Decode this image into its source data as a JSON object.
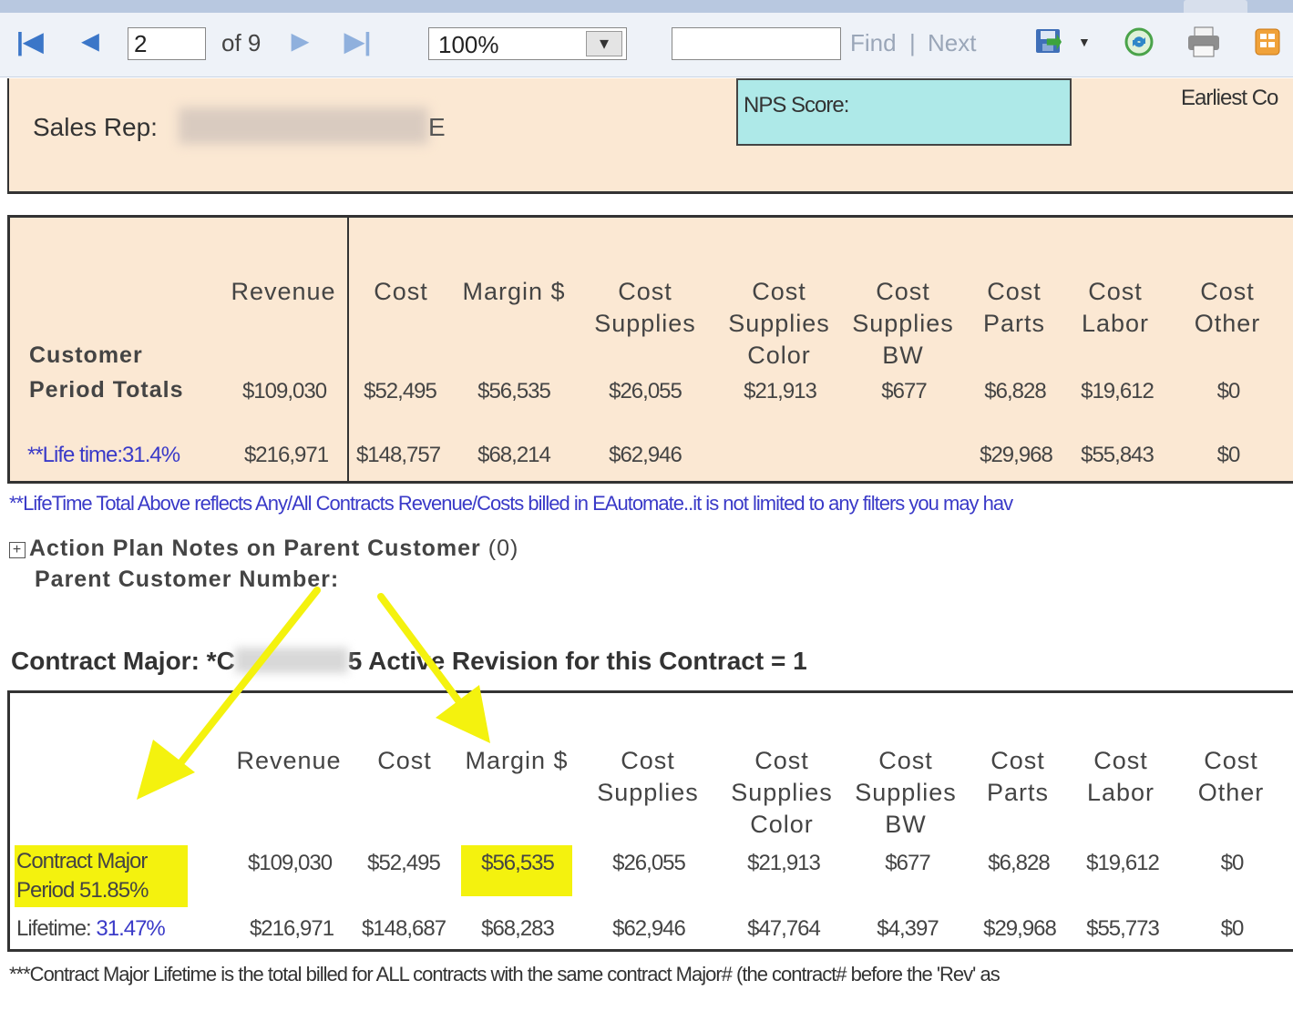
{
  "toolbar": {
    "page_value": "2",
    "of_label": "of 9",
    "zoom_value": "100%",
    "find_value": "",
    "find_label": "Find",
    "find_sep": "|",
    "next_label": "Next"
  },
  "header": {
    "sales_rep_label": "Sales Rep:",
    "sales_rep_suffix": "E",
    "nps_label": "NPS Score:",
    "earliest_label": "Earliest Co"
  },
  "customer_table": {
    "headers": [
      [
        "Revenue"
      ],
      [
        "Cost"
      ],
      [
        "Margin $"
      ],
      [
        "Cost",
        "Supplies"
      ],
      [
        "Cost",
        "Supplies",
        "Color"
      ],
      [
        "Cost",
        "Supplies",
        "BW"
      ],
      [
        "Cost",
        "Parts"
      ],
      [
        "Cost",
        "Labor"
      ],
      [
        "Cost",
        "Other"
      ]
    ],
    "row_label_1": "Customer",
    "row_label_2": "Period Totals",
    "period_values": [
      "$109,030",
      "$52,495",
      "$56,535",
      "$26,055",
      "$21,913",
      "$677",
      "$6,828",
      "$19,612",
      "$0"
    ],
    "lifetime_label": "**Life time:31.4%",
    "lifetime_values": [
      "$216,971",
      "$148,757",
      "$68,214",
      "$62,946",
      "",
      "",
      "$29,968",
      "$55,843",
      "$0"
    ]
  },
  "lifetime_note": "**LifeTime Total Above reflects Any/All Contracts Revenue/Costs billed in EAutomate..it is not limited to any filters you may hav",
  "action_plan": {
    "expand_glyph": "+",
    "label": "Action Plan Notes on Parent Customer",
    "count": "(0)"
  },
  "parent_customer_label": "Parent Customer Number:",
  "contract_title": {
    "prefix": "Contract Major: *C",
    "suffix": "5 Active Revision for this Contract = 1"
  },
  "contract_table": {
    "headers": [
      [
        "Revenue"
      ],
      [
        "Cost"
      ],
      [
        "Margin $"
      ],
      [
        "Cost",
        "Supplies"
      ],
      [
        "Cost",
        "Supplies",
        "Color"
      ],
      [
        "Cost",
        "Supplies",
        "BW"
      ],
      [
        "Cost",
        "Parts"
      ],
      [
        "Cost",
        "Labor"
      ],
      [
        "Cost",
        "Other"
      ]
    ],
    "period_label_1": "Contract Major",
    "period_label_2": "Period 51.85%",
    "period_values": [
      "$109,030",
      "$52,495",
      "$56,535",
      "$26,055",
      "$21,913",
      "$677",
      "$6,828",
      "$19,612",
      "$0"
    ],
    "lifetime_label": "Lifetime:",
    "lifetime_pct": "31.47%",
    "lifetime_values": [
      "$216,971",
      "$148,687",
      "$68,283",
      "$62,946",
      "$47,764",
      "$4,397",
      "$29,968",
      "$55,773",
      "$0"
    ]
  },
  "contract_note": "***Contract Major Lifetime is the total billed for ALL contracts with the same contract Major# (the contract# before the 'Rev' as",
  "colors": {
    "panel": "#fbe8d3",
    "nps": "#aee9e8",
    "highlight": "#f4f20e",
    "arrow": "#f4f20e",
    "link": "#3a3ac8"
  }
}
